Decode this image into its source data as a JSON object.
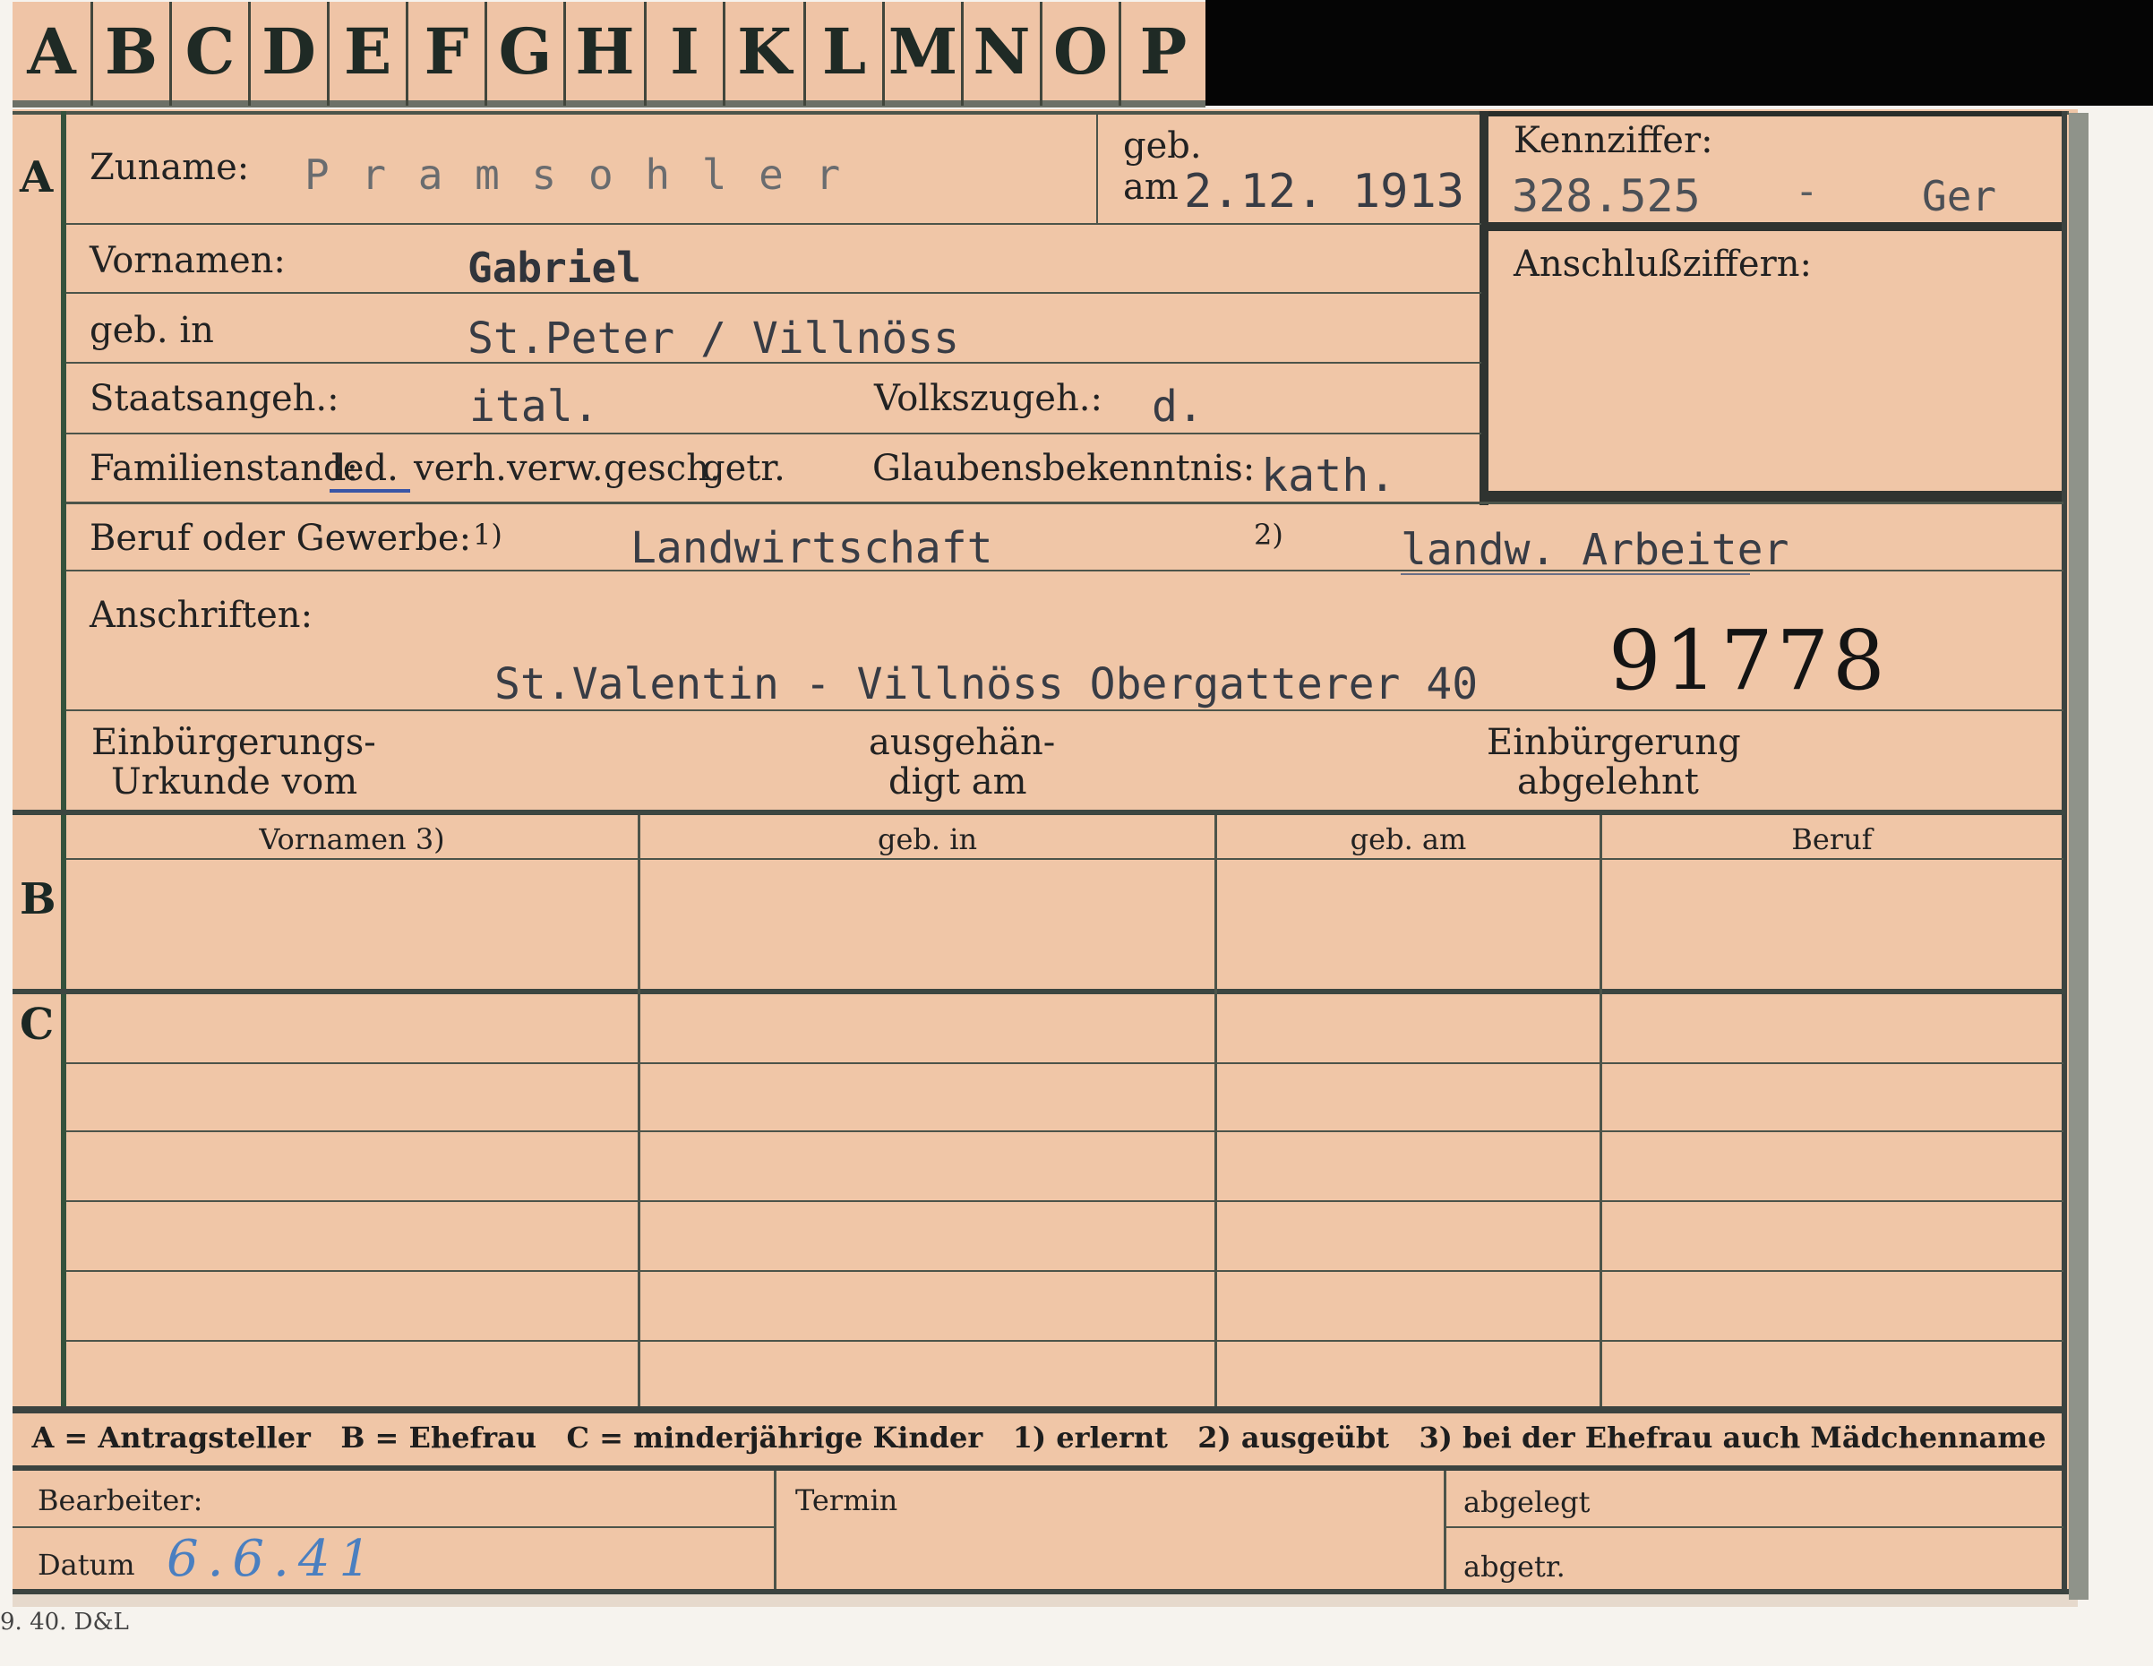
{
  "tabs": [
    "A",
    "B",
    "C",
    "D",
    "E",
    "F",
    "G",
    "H",
    "I",
    "K",
    "L",
    "M",
    "N",
    "O",
    "P"
  ],
  "sections": {
    "a": "A",
    "b": "B",
    "c": "C"
  },
  "header": {
    "surname_label": "Zuname:",
    "surname_value": "P r a m s o h l e r",
    "born_label_1": "geb.",
    "born_label_2": "am",
    "born_value": "2.12. 1913",
    "id_label": "Kennziffer:",
    "id_value": "328.525",
    "id_dash": "-",
    "id_suffix": "Ger",
    "link_label": "Anschlußziffern:"
  },
  "person": {
    "firstname_label": "Vornamen:",
    "firstname_value": "Gabriel",
    "birthplace_label": "geb. in",
    "birthplace_value": "St.Peter / Villnöss",
    "citizenship_label": "Staatsangeh.:",
    "citizenship_value": "ital.",
    "ethnicity_label": "Volkszugeh.:",
    "ethnicity_value": "d.",
    "marital_label": "Familienstand:",
    "marital_options": [
      "led.",
      "verh.",
      "verw.",
      "gesch.",
      "getr."
    ],
    "marital_selected": "led.",
    "religion_label": "Glaubensbekenntnis:",
    "religion_value": "kath."
  },
  "occupation": {
    "label": "Beruf oder Gewerbe:",
    "note1": "1)",
    "learned": "Landwirtschaft",
    "note2": "2)",
    "practiced": "landw. Arbeiter"
  },
  "address": {
    "label": "Anschriften:",
    "value": "St.Valentin - Villnöss Obergatterer 40",
    "stamp_number": "91778"
  },
  "naturalization": {
    "deed_label_1": "Einbürgerungs-",
    "deed_label_2": "Urkunde vom",
    "issued_label_1": "ausgehän-",
    "issued_label_2": "digt am",
    "refused_label_1": "Einbürgerung",
    "refused_label_2": "abgelehnt"
  },
  "table": {
    "headers": [
      "Vornamen 3)",
      "geb. in",
      "geb. am",
      "Beruf"
    ]
  },
  "legend": "A = Antragsteller   B = Ehefrau   C = minderjährige Kinder   1) erlernt   2) ausgeübt   3) bei der Ehefrau auch Mädchenname",
  "footer": {
    "clerk_label": "Bearbeiter:",
    "date_label": "Datum",
    "date_value": "6.6.41",
    "deadline_label": "Termin",
    "filed_label": "abgelegt",
    "separated_label": "abgetr."
  },
  "form_number": "9. 40. D&L",
  "colors": {
    "card": "#f0c6a7",
    "line": "#4c544a",
    "section_green": "#34523c",
    "typed_ink": "#383c45",
    "pen_ink": "#4a7fc0"
  }
}
